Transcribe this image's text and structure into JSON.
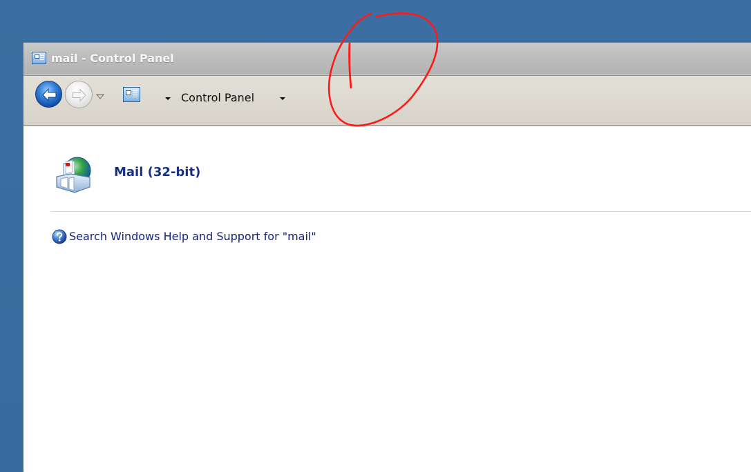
{
  "window": {
    "title": "mail - Control Panel",
    "icon": "control-panel-icon"
  },
  "navbar": {
    "back_icon": "back-arrow-icon",
    "forward_icon": "forward-arrow-icon",
    "history_icon": "chevron-down-icon",
    "location_icon": "control-panel-icon",
    "breadcrumb": "Control Panel"
  },
  "content": {
    "result_title": "Mail (32-bit)",
    "result_icon": "mail-icon",
    "help_text": "Search Windows Help and Support for \"mail\"",
    "help_icon": "help-icon"
  },
  "colors": {
    "desktop": "#3a6ea5",
    "link": "#1a2e82",
    "annotation": "#ff0000"
  }
}
